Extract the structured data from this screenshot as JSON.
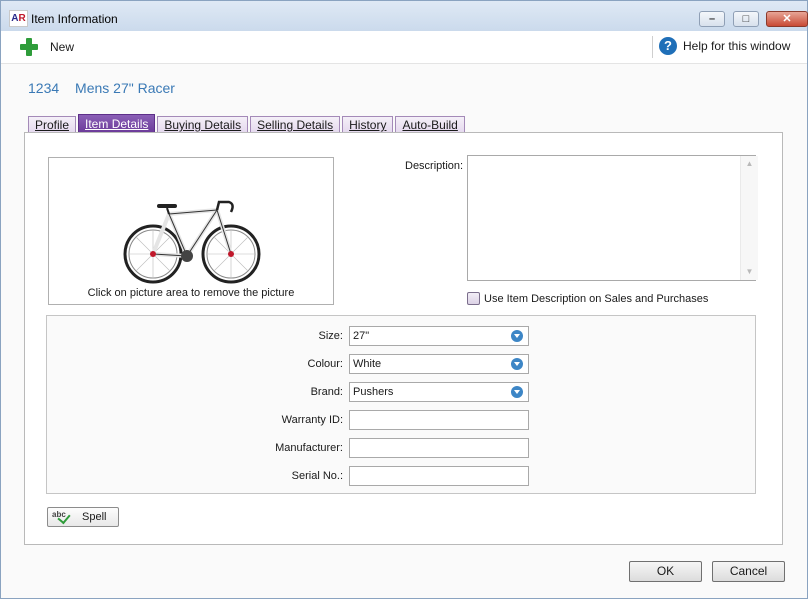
{
  "window": {
    "title": "Item Information",
    "app_icon_text": [
      "A",
      "R"
    ]
  },
  "titlebar_buttons": {
    "minimize": "–",
    "maximize": "□",
    "close": "✕"
  },
  "toolbar": {
    "new_label": "New",
    "help_label": "Help for this window",
    "help_glyph": "?"
  },
  "item": {
    "number": "1234",
    "name": "Mens 27\" Racer"
  },
  "tabs": [
    {
      "label": "Profile",
      "active": false
    },
    {
      "label": "Item Details",
      "active": true
    },
    {
      "label": "Buying Details",
      "active": false
    },
    {
      "label": "Selling Details",
      "active": false
    },
    {
      "label": "History",
      "active": false
    },
    {
      "label": "Auto-Build",
      "active": false
    }
  ],
  "picture": {
    "caption": "Click on picture area to remove the picture"
  },
  "description": {
    "label": "Description:",
    "value": "",
    "scroll_up": "▲",
    "scroll_down": "▼"
  },
  "use_description_checkbox": {
    "label": "Use Item Description on Sales and Purchases",
    "checked": false
  },
  "fields": {
    "size": {
      "label": "Size:",
      "value": "27\""
    },
    "colour": {
      "label": "Colour:",
      "value": "White"
    },
    "brand": {
      "label": "Brand:",
      "value": "Pushers"
    },
    "warranty": {
      "label": "Warranty ID:",
      "value": ""
    },
    "manufacturer": {
      "label": "Manufacturer:",
      "value": ""
    },
    "serial": {
      "label": "Serial No.:",
      "value": ""
    }
  },
  "spell": {
    "label": "Spell",
    "icon_text": "abc"
  },
  "footer": {
    "ok_label": "OK",
    "cancel_label": "Cancel"
  },
  "colors": {
    "tab_active": "#6b3a99",
    "accent_blue": "#3a79b5",
    "add_green": "#2e9c3a"
  }
}
